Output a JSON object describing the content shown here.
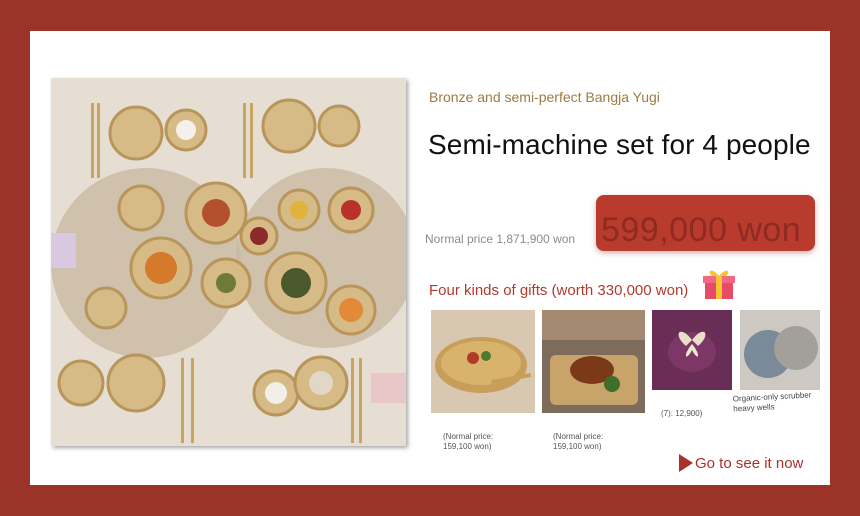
{
  "product": {
    "subtitle": "Bronze and semi-perfect Bangja Yugi",
    "title": "Semi-machine set for 4 people",
    "normal_price_label": "Normal price 1,871,900 won",
    "sale_price": "599,000 won"
  },
  "gifts": {
    "heading": "Four kinds of gifts (worth 330,000 won)",
    "items": [
      {
        "caption": "(Normal price: 159,100 won)"
      },
      {
        "caption": "(Normal price: 159,100 won)"
      },
      {
        "caption": "(7): 12,900)"
      },
      {
        "caption": "Organic-only scrubber heavy wells"
      }
    ]
  },
  "cta": {
    "label": "Go to see it now"
  },
  "colors": {
    "frame": "#9a3328",
    "accent": "#b03a2d",
    "subtitle": "#a07a45"
  },
  "icons": [
    "gift-box-icon",
    "play-arrow-icon"
  ]
}
